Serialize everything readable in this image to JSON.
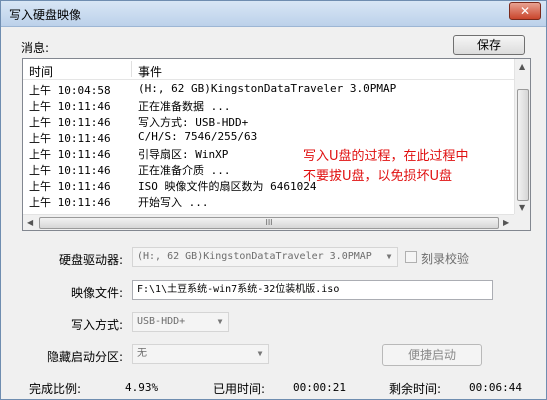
{
  "window": {
    "title": "写入硬盘映像",
    "close_glyph": "✕"
  },
  "messages": {
    "label": "消息:",
    "save_label": "保存",
    "columns": {
      "time": "时间",
      "event": "事件"
    },
    "rows": [
      {
        "time": "上午 10:04:58",
        "event": "(H:, 62 GB)KingstonDataTraveler 3.0PMAP"
      },
      {
        "time": "上午 10:11:46",
        "event": "正在准备数据 ..."
      },
      {
        "time": "上午 10:11:46",
        "event": "写入方式: USB-HDD+"
      },
      {
        "time": "上午 10:11:46",
        "event": "C/H/S: 7546/255/63"
      },
      {
        "time": "上午 10:11:46",
        "event": "引导扇区: WinXP"
      },
      {
        "time": "上午 10:11:46",
        "event": "正在准备介质 ..."
      },
      {
        "time": "上午 10:11:46",
        "event": "ISO 映像文件的扇区数为 6461024"
      },
      {
        "time": "上午 10:11:46",
        "event": "开始写入 ..."
      }
    ],
    "scroll_grip": "III"
  },
  "annotation": {
    "line1": "写入U盘的过程，在此过程中",
    "line2": "不要拔U盘，以免损坏U盘",
    "color": "#e01010"
  },
  "form": {
    "drive_label": "硬盘驱动器:",
    "drive_value": "(H:, 62 GB)KingstonDataTraveler 3.0PMAP",
    "verify_label": "刻录校验",
    "verify_checked": false,
    "image_label": "映像文件:",
    "image_value": "F:\\1\\土豆系统-win7系统-32位装机版.iso",
    "write_mode_label": "写入方式:",
    "write_mode_value": "USB-HDD+",
    "hidden_partition_label": "隐藏启动分区:",
    "hidden_partition_value": "无",
    "quick_boot_label": "便捷启动"
  },
  "status": {
    "progress_label": "完成比例:",
    "progress_value": "4.93%",
    "elapsed_label": "已用时间:",
    "elapsed_value": "00:00:21",
    "remaining_label": "剩余时间:",
    "remaining_value": "00:06:44"
  }
}
